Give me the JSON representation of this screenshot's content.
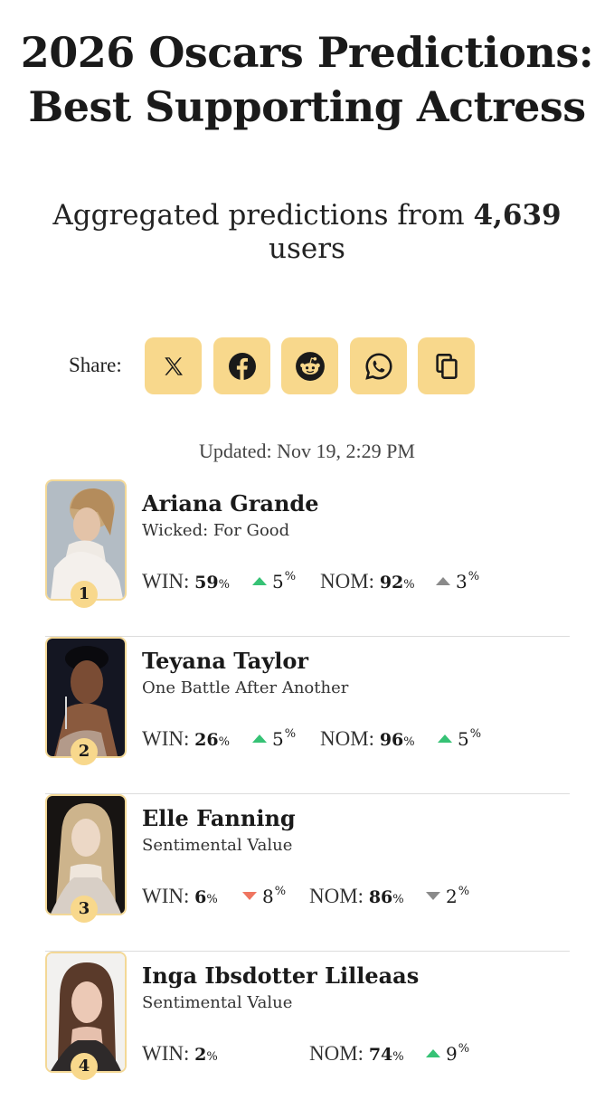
{
  "page": {
    "title": "2026 Oscars Predictions: Best Supporting Actress",
    "subtitle_prefix": "Aggregated predictions from ",
    "subtitle_count": "4,639",
    "subtitle_suffix": " users"
  },
  "share": {
    "label": "Share:",
    "buttons": [
      {
        "name": "x-share-button",
        "icon": "x-logo-icon"
      },
      {
        "name": "facebook-share-button",
        "icon": "facebook-icon"
      },
      {
        "name": "reddit-share-button",
        "icon": "reddit-icon"
      },
      {
        "name": "whatsapp-share-button",
        "icon": "whatsapp-icon"
      },
      {
        "name": "copy-link-button",
        "icon": "copy-icon"
      }
    ],
    "button_color": "#f8d88c"
  },
  "updated": "Updated: Nov 19, 2:29 PM",
  "labels": {
    "win": "WIN:",
    "nom": "NOM:",
    "pct": "%"
  },
  "colors": {
    "up": "#36c275",
    "down": "#ef7560",
    "neutral": "#8a8a8a",
    "accent": "#f8d88c"
  },
  "nominees": [
    {
      "rank": "1",
      "name": "Ariana Grande",
      "film": "Wicked: For Good",
      "win": "59",
      "win_change": "5",
      "win_dir": "up-green",
      "nom": "92",
      "nom_change": "3",
      "nom_dir": "up-gray"
    },
    {
      "rank": "2",
      "name": "Teyana Taylor",
      "film": "One Battle After Another",
      "win": "26",
      "win_change": "5",
      "win_dir": "up-green",
      "nom": "96",
      "nom_change": "5",
      "nom_dir": "up-green"
    },
    {
      "rank": "3",
      "name": "Elle Fanning",
      "film": "Sentimental Value",
      "win": "6",
      "win_change": "8",
      "win_dir": "down-red",
      "nom": "86",
      "nom_change": "2",
      "nom_dir": "down-gray"
    },
    {
      "rank": "4",
      "name": "Inga Ibsdotter Lilleaas",
      "film": "Sentimental Value",
      "win": "2",
      "win_change": "",
      "win_dir": "",
      "nom": "74",
      "nom_change": "9",
      "nom_dir": "up-green"
    }
  ]
}
